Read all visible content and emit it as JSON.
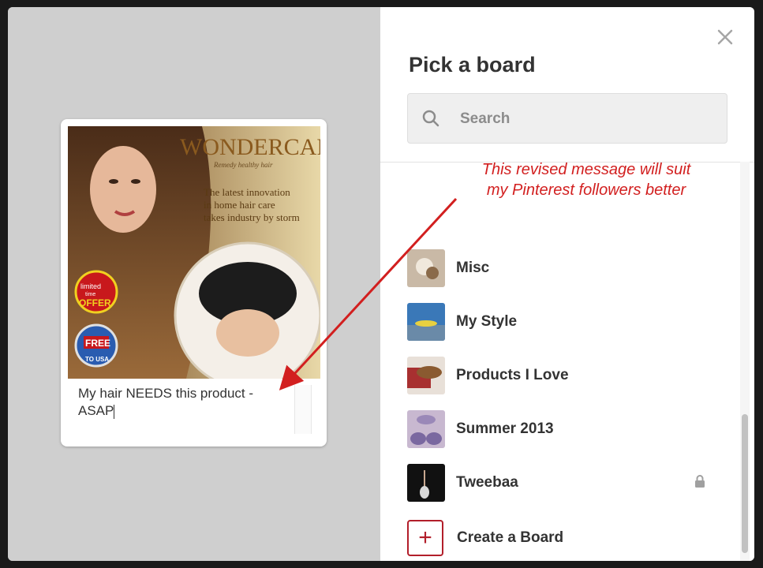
{
  "modal": {
    "title": "Pick a board",
    "close_icon": "close-icon",
    "search": {
      "placeholder": "Search"
    }
  },
  "pin": {
    "brand_text": "WONDERCAP",
    "brand_tagline": "Remedy healthy hair",
    "headline_lines": [
      "The latest innovation",
      "in home hair care",
      "takes industry by storm"
    ],
    "badge_offer": [
      "limited",
      "time",
      "OFFER"
    ],
    "badge_shipping": [
      "FREE",
      "TO USA"
    ],
    "caption": "My hair NEEDS this product - ASAP"
  },
  "boards": [
    {
      "label": "Misc",
      "thumb_color": "#b8a590",
      "locked": false
    },
    {
      "label": "My Style",
      "thumb_color": "#3a78b8",
      "locked": false
    },
    {
      "label": "Products I Love",
      "thumb_color": "#8a4d3a",
      "locked": false
    },
    {
      "label": "Summer 2013",
      "thumb_color": "#8a78a8",
      "locked": false
    },
    {
      "label": "Tweebaa",
      "thumb_color": "#1c1c1c",
      "locked": true
    }
  ],
  "create_board": {
    "label": "Create a Board",
    "icon": "plus-icon"
  },
  "annotation": {
    "lines": [
      "This revised message will suit",
      "my Pinterest followers better"
    ],
    "color": "#d21f1f"
  }
}
